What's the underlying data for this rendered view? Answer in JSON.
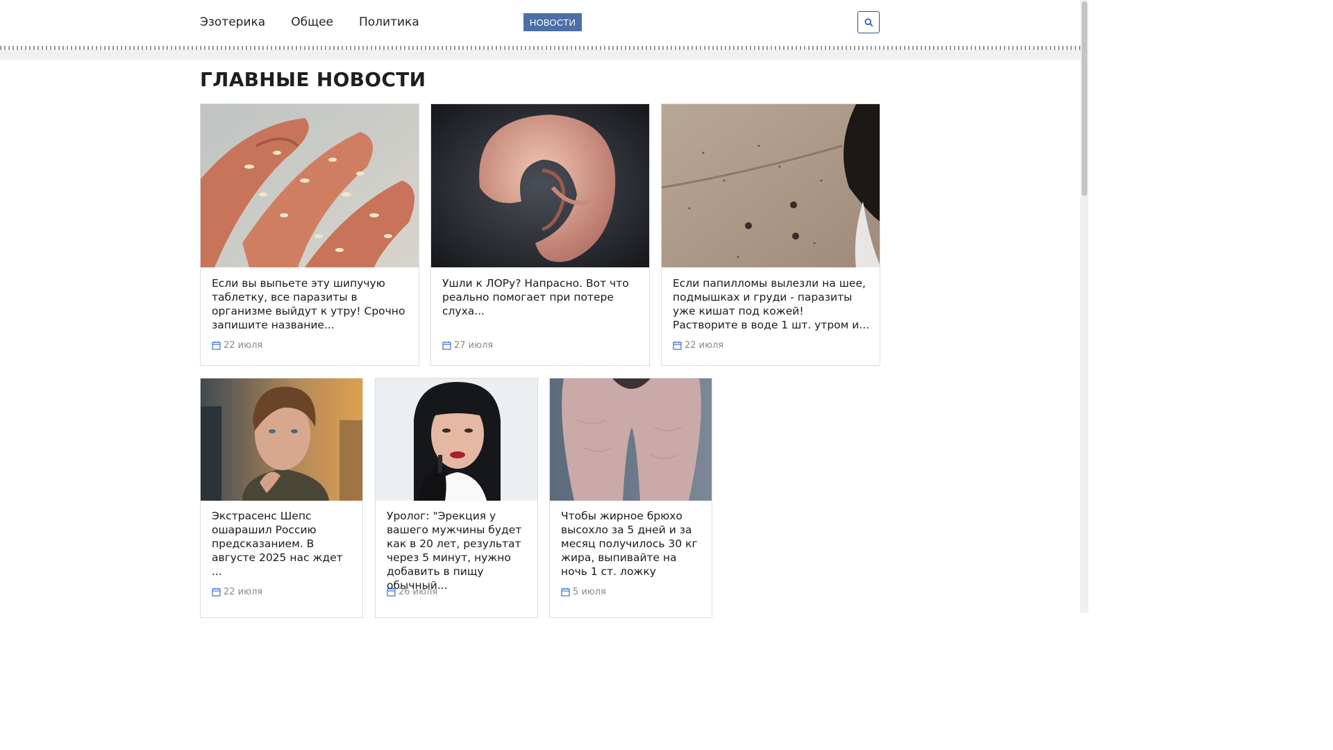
{
  "nav": {
    "items": [
      "Эзотерика",
      "Общее",
      "Политика"
    ],
    "news_label": "НОВОСТИ",
    "search_icon": "search-icon"
  },
  "section_title": "ГЛАВНЫЕ НОВОСТИ",
  "cards": [
    {
      "title": "Если вы выпьете эту шипучую таблетку, все паразиты в организме выйдут к утру! Срочно запишите название...",
      "date": "22 июля",
      "image": "fingers-with-parasites"
    },
    {
      "title": "Ушли к ЛОРу? Напрасно. Вот что реально помогает при потере слуха...",
      "date": "27 июля",
      "image": "ear-closeup"
    },
    {
      "title": "Если папилломы вылезли на шее, подмышках и груди - паразиты уже кишат под кожей! Растворите в воде 1 шт. утром и...",
      "date": "22 июля",
      "image": "neck-papillomas"
    },
    {
      "title": "Экстрасенс Шепс ошарашил Россию предсказанием. В августе 2025 нас ждет ...",
      "date": "22 июля",
      "image": "man-portrait"
    },
    {
      "title": "Уролог: \"Эрекция у вашего мужчины будет как в 20 лет, результат через 5 минут, нужно добавить в пищу обычный...",
      "date": "26 июля",
      "image": "doctor-woman"
    },
    {
      "title": "Чтобы жирное брюхо высохло за 5 дней и за месяц получилось 30 кг жира, выпивайте на ночь 1 ст. ложку",
      "date": "5 июля",
      "image": "thighs-cellulite"
    }
  ],
  "colors": {
    "accent": "#4c6fa8",
    "search_border": "#2f4f8a",
    "date_icon": "#3b6fd6"
  }
}
